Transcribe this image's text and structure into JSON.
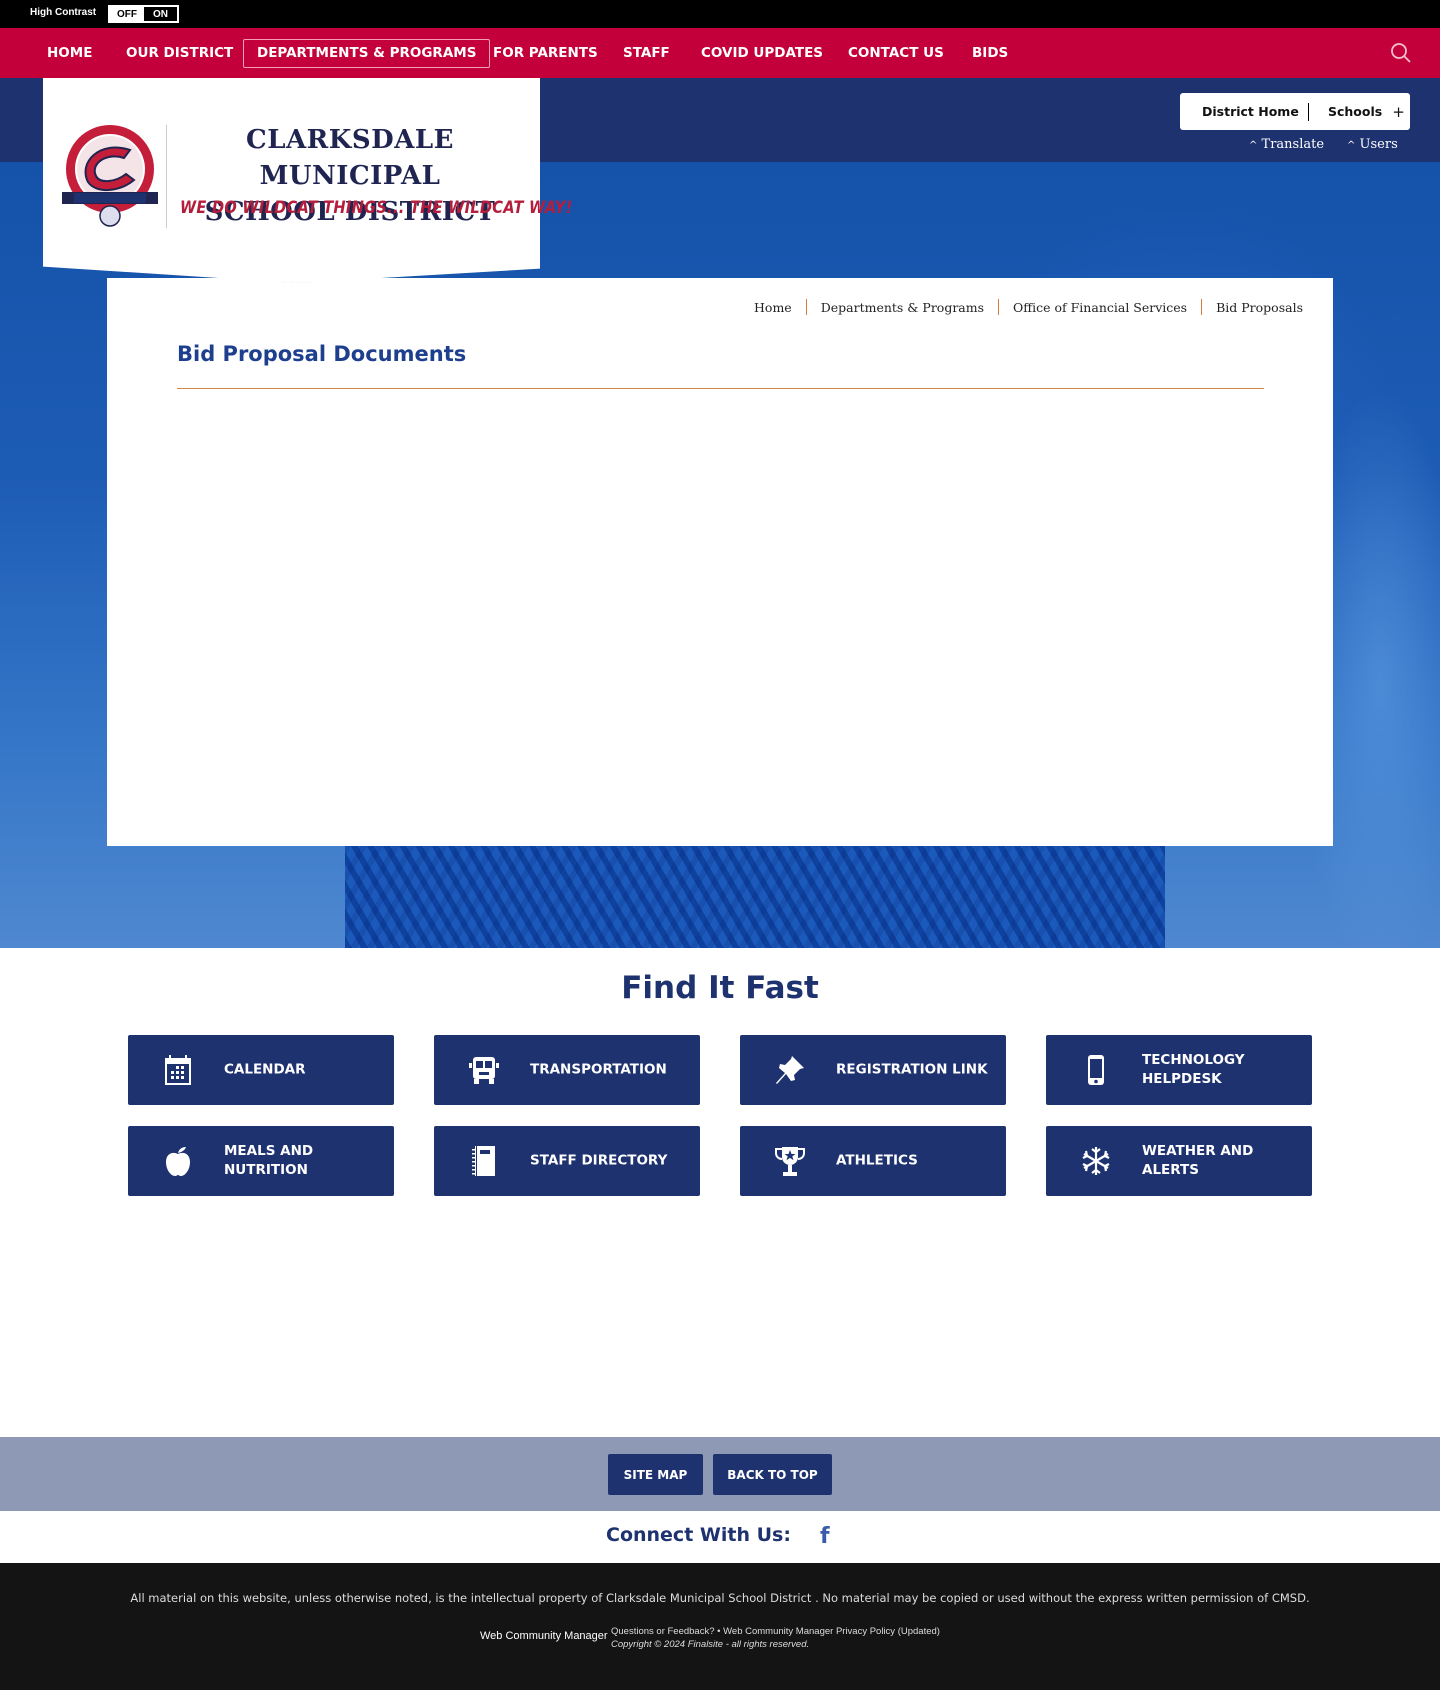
{
  "high_contrast": {
    "label": "High Contrast",
    "off": "OFF",
    "on": "ON"
  },
  "nav": {
    "items": [
      {
        "label": "HOME"
      },
      {
        "label": "OUR DISTRICT"
      },
      {
        "label": "DEPARTMENTS & PROGRAMS",
        "active": true
      },
      {
        "label": "FOR PARENTS"
      },
      {
        "label": "STAFF"
      },
      {
        "label": "COVID UPDATES"
      },
      {
        "label": "CONTACT US"
      },
      {
        "label": "BIDS"
      }
    ],
    "search_icon": "search-icon"
  },
  "logo": {
    "name_line1": "CLARKSDALE MUNICIPAL",
    "name_line2": "SCHOOL DISTRICT",
    "tagline": "WE DO WILDCAT THINGS... THE WILDCAT WAY!"
  },
  "header_utils": {
    "district_home": "District Home",
    "schools": "Schools",
    "schools_icon": "+",
    "translate": "Translate",
    "users": "Users",
    "caret": "^"
  },
  "breadcrumb": [
    "Home",
    "Departments & Programs",
    "Office of Financial Services",
    "Bid Proposals"
  ],
  "page": {
    "title": "Bid Proposal Documents"
  },
  "find_it_fast": {
    "title": "Find It Fast",
    "buttons": [
      {
        "label": "CALENDAR",
        "icon": "calendar-icon"
      },
      {
        "label": "TRANSPORTATION",
        "icon": "bus-icon"
      },
      {
        "label": "REGISTRATION LINK",
        "icon": "pushpin-icon"
      },
      {
        "label": "TECHNOLOGY HELPDESK",
        "icon": "phone-icon"
      },
      {
        "label": "MEALS AND NUTRITION",
        "icon": "apple-icon"
      },
      {
        "label": "STAFF DIRECTORY",
        "icon": "notebook-icon"
      },
      {
        "label": "ATHLETICS",
        "icon": "trophy-icon"
      },
      {
        "label": "WEATHER AND ALERTS",
        "icon": "snowflake-icon"
      }
    ]
  },
  "footer": {
    "site_map": "SITE MAP",
    "back_to_top": "BACK TO TOP",
    "connect": "Connect With Us:",
    "facebook": "f",
    "legal": "All material on this website, unless otherwise noted, is the intellectual property of Clarksdale Municipal School District . No material may be copied or used without the express written permission of CMSD.",
    "wcm_logo": "Web Community Manager",
    "questions": "Questions or Feedback?",
    "bullet": "•",
    "privacy": "Web Community Manager Privacy Policy (Updated)",
    "copyright": "Copyright © 2024 Finalsite - all rights reserved."
  },
  "colors": {
    "nav_red": "#c4003a",
    "navy": "#1f3270",
    "title_blue": "#1d3f8e",
    "accent_orange": "#d48847",
    "tagline_red": "#b41e3c"
  }
}
